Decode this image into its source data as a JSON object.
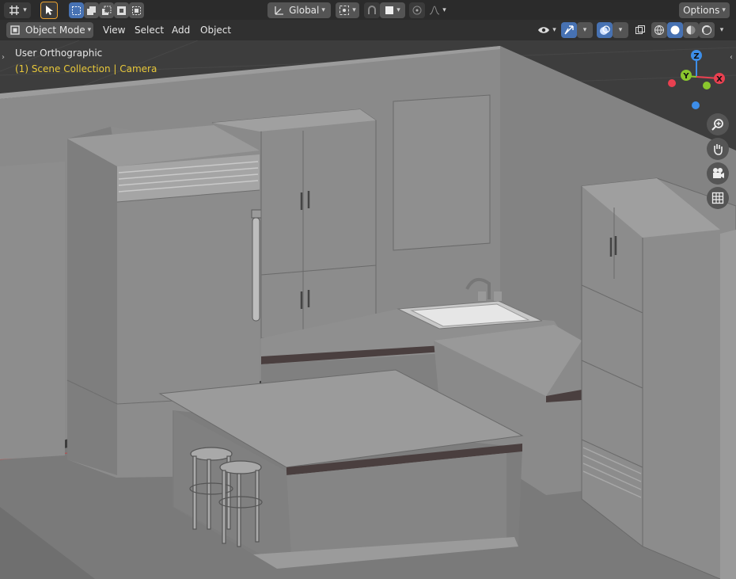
{
  "topbar": {
    "editor_type_icon": "editor-type-icon",
    "select_tool_icon": "select-cursor-icon",
    "select_modes": [
      "select-new-icon",
      "select-extend-icon",
      "select-subtract-icon",
      "select-invert-icon",
      "select-intersect-icon"
    ],
    "transform_orientation": "Global",
    "pivot_icon": "pivot-point-icon",
    "snap_icon": "snap-icon",
    "snap_target_icon": "snap-increment-icon",
    "proportional_icon": "proportional-edit-icon",
    "falloff_icon": "falloff-icon",
    "options_label": "Options"
  },
  "header": {
    "mode_label": "Object Mode",
    "menus": [
      "View",
      "Select",
      "Add",
      "Object"
    ],
    "visibility_icon": "eye-icon",
    "gizmo_icon": "gizmo-icon",
    "overlay_icon": "overlay-icon",
    "xray_icon": "xray-icon",
    "shading_icons": [
      "wireframe-shading-icon",
      "solid-shading-icon",
      "material-shading-icon",
      "rendered-shading-icon"
    ]
  },
  "viewport": {
    "view_name": "User Orthographic",
    "collection_label": "(1) Scene Collection | Camera",
    "axes": {
      "z": "Z",
      "y": "Y",
      "x": "X"
    },
    "colors": {
      "x_axis": "#e94050",
      "y_axis": "#8ac72d",
      "z_axis": "#3d8ee9",
      "label_yellow": "#e8c83a"
    },
    "nav_icons": [
      "zoom-icon",
      "hand-pan-icon",
      "camera-view-icon",
      "grid-ortho-icon"
    ]
  }
}
